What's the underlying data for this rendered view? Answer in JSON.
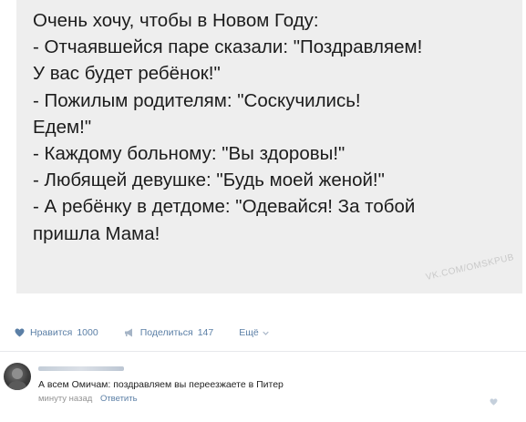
{
  "post": {
    "text_lines": [
      "Очень хочу, чтобы в Новом Году:",
      "- Отчаявшейся паре сказали: \"Поздравляем!",
      "У вас будет ребёнок!\"",
      "- Пожилым родителям: \"Соскучились!",
      "Едем!\"",
      "- Каждому больному: \"Вы здоровы!\"",
      "- Любящей девушке: \"Будь моей женой!\"",
      "- А ребёнку в детдоме: \"Одевайся! За тобой",
      "пришла Мама!"
    ],
    "watermark": "VK.COM/OMSKPUB"
  },
  "actions": {
    "like_label": "Нравится",
    "like_count": "1000",
    "share_label": "Поделиться",
    "share_count": "147",
    "more_label": "Ещё"
  },
  "comment": {
    "text": "А всем Омичам: поздравляем вы переезжаете в Питер",
    "time": "минуту назад",
    "reply_label": "Ответить"
  },
  "icons": {
    "like": "heart-icon",
    "share": "megaphone-icon",
    "more": "chevron-down-icon",
    "comment_like": "heart-icon"
  },
  "colors": {
    "link": "#5b7fa6",
    "muted": "#939393",
    "image_background": "#eeeeee"
  }
}
